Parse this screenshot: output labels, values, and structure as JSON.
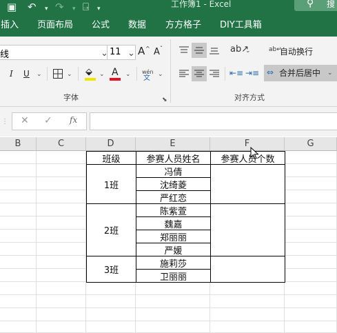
{
  "window": {
    "title": "工作簿1 - Excel",
    "search_label": "搜"
  },
  "tabs": [
    "插入",
    "页面布局",
    "公式",
    "数据",
    "方方格子",
    "DIY工具箱"
  ],
  "ribbon": {
    "font_name": "线",
    "font_size": "11",
    "grow_font": "A",
    "shrink_font": "A",
    "italic": "I",
    "underline": "U",
    "font_color_glyph": "A",
    "highlight_color": "#f2e600",
    "font_color": "#e81123",
    "phonetic_top": "wén",
    "phonetic_bottom": "文",
    "wrap_text": "自动换行",
    "merge_center": "合并后居中",
    "group_font": "字体",
    "group_alignment": "对齐方式"
  },
  "formula_bar": {
    "cancel_glyph": "✕",
    "enter_glyph": "✓",
    "fx_glyph": "fx",
    "content": ""
  },
  "columns": [
    "B",
    "C",
    "D",
    "E",
    "F",
    "G"
  ],
  "table": {
    "headers": [
      "班级",
      "参赛人员姓名",
      "参赛人员个数"
    ],
    "groups": [
      {
        "class": "1班",
        "names": [
          "冯倩",
          "沈绮菱",
          "严红恋"
        ]
      },
      {
        "class": "2班",
        "names": [
          "陈紫萱",
          "魏嘉",
          "郑丽丽",
          "严媛"
        ]
      },
      {
        "class": "3班",
        "names": [
          "施莉莎",
          "卫丽丽"
        ]
      }
    ]
  }
}
